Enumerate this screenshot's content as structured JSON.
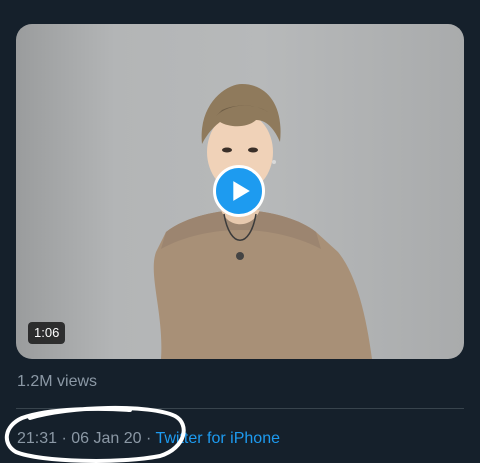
{
  "video": {
    "duration": "1:06",
    "play_icon": "play-icon"
  },
  "stats": {
    "views": "1.2M views"
  },
  "tweet_meta": {
    "time": "21:31",
    "separator1": " · ",
    "date": "06 Jan 20",
    "separator2": " · ",
    "source": "Twitter for iPhone"
  },
  "colors": {
    "background": "#15202b",
    "accent": "#1d9bf0",
    "muted_text": "#8b98a5",
    "annotation": "#ffffff"
  }
}
